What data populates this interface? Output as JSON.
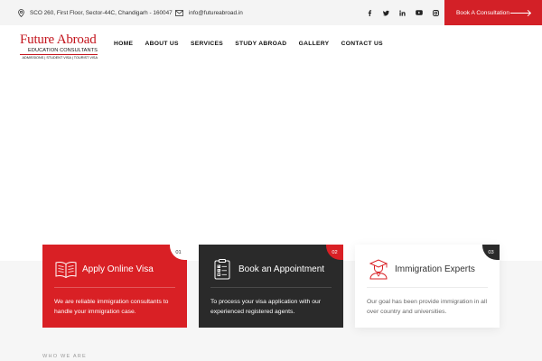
{
  "topbar": {
    "address": "SCO 260, First Floor, Sector-44C, Chandigarh - 160047",
    "email": "info@futureabroad.in",
    "social": [
      "facebook-icon",
      "twitter-icon",
      "linkedin-icon",
      "youtube-icon",
      "instagram-icon"
    ],
    "book_label": "Book A Consultation"
  },
  "logo": {
    "word1": "Future",
    "word2": "Abroad",
    "subtitle": "EDUCATION CONSULTANTS",
    "tagline": "ADMISSIONS | STUDENT VISA | TOURIST VISA"
  },
  "nav": [
    "HOME",
    "ABOUT US",
    "SERVICES",
    "STUDY ABROAD",
    "GALLERY",
    "CONTACT US"
  ],
  "cards": [
    {
      "num": "01",
      "title": "Apply Online Visa",
      "desc": "We are reliable immigration consultants to handle your immigration case.",
      "icon": "open-book-icon"
    },
    {
      "num": "02",
      "title": "Book an Appointment",
      "desc": "To process your visa application with our experienced registered agents.",
      "icon": "clipboard-checklist-icon"
    },
    {
      "num": "03",
      "title": "Immigration Experts",
      "desc": "Our goal has been provide immigration in all over country and universities.",
      "icon": "graduate-icon"
    }
  ],
  "section_label": "WHO WE ARE",
  "colors": {
    "brand_red": "#d92025",
    "dark": "#2a2a2a",
    "topbar_bg": "#f4f4f4"
  }
}
